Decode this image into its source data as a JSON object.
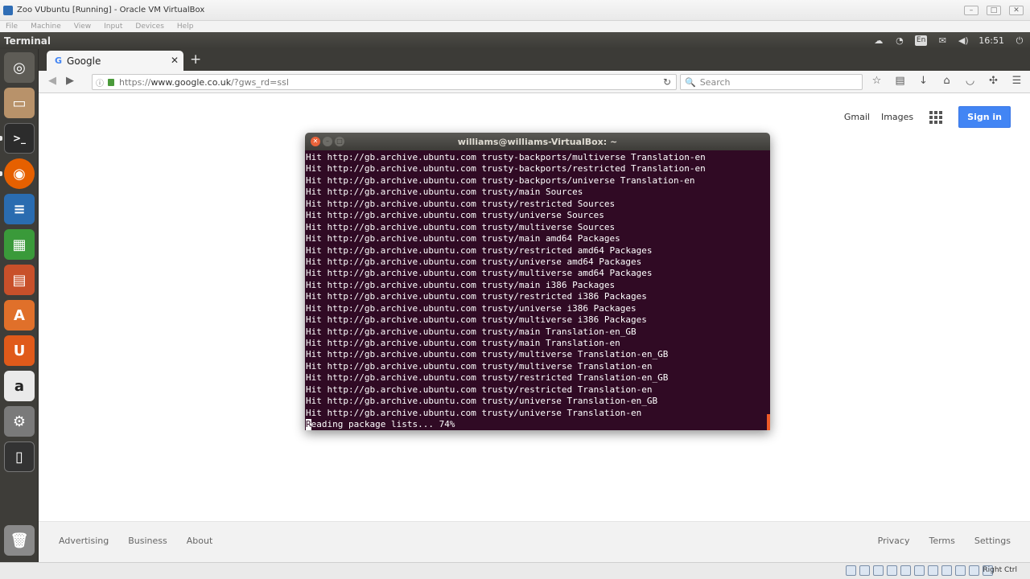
{
  "vbox": {
    "title": "Zoo VUbuntu [Running] - Oracle VM VirtualBox",
    "menu": [
      "File",
      "Machine",
      "View",
      "Input",
      "Devices",
      "Help"
    ],
    "host_key": "Right Ctrl"
  },
  "ubuntu_panel": {
    "app_title": "Terminal",
    "keyboard_layout": "En",
    "clock": "16:51"
  },
  "firefox": {
    "tab_title": "Google",
    "url_scheme": "https://",
    "url_host": "www.google.co.uk",
    "url_path": "/?gws_rd=ssl",
    "search_placeholder": "Search"
  },
  "google": {
    "header_links": {
      "gmail": "Gmail",
      "images": "Images",
      "sign_in": "Sign in"
    },
    "footer_left": [
      "Advertising",
      "Business",
      "About"
    ],
    "footer_right": [
      "Privacy",
      "Terms",
      "Settings"
    ],
    "accent_color": "#4285f4"
  },
  "terminal": {
    "title": "williams@williams-VirtualBox: ~",
    "lines": [
      "Hit http://gb.archive.ubuntu.com trusty-backports/multiverse Translation-en",
      "Hit http://gb.archive.ubuntu.com trusty-backports/restricted Translation-en",
      "Hit http://gb.archive.ubuntu.com trusty-backports/universe Translation-en",
      "Hit http://gb.archive.ubuntu.com trusty/main Sources",
      "Hit http://gb.archive.ubuntu.com trusty/restricted Sources",
      "Hit http://gb.archive.ubuntu.com trusty/universe Sources",
      "Hit http://gb.archive.ubuntu.com trusty/multiverse Sources",
      "Hit http://gb.archive.ubuntu.com trusty/main amd64 Packages",
      "Hit http://gb.archive.ubuntu.com trusty/restricted amd64 Packages",
      "Hit http://gb.archive.ubuntu.com trusty/universe amd64 Packages",
      "Hit http://gb.archive.ubuntu.com trusty/multiverse amd64 Packages",
      "Hit http://gb.archive.ubuntu.com trusty/main i386 Packages",
      "Hit http://gb.archive.ubuntu.com trusty/restricted i386 Packages",
      "Hit http://gb.archive.ubuntu.com trusty/universe i386 Packages",
      "Hit http://gb.archive.ubuntu.com trusty/multiverse i386 Packages",
      "Hit http://gb.archive.ubuntu.com trusty/main Translation-en_GB",
      "Hit http://gb.archive.ubuntu.com trusty/main Translation-en",
      "Hit http://gb.archive.ubuntu.com trusty/multiverse Translation-en_GB",
      "Hit http://gb.archive.ubuntu.com trusty/multiverse Translation-en",
      "Hit http://gb.archive.ubuntu.com trusty/restricted Translation-en_GB",
      "Hit http://gb.archive.ubuntu.com trusty/restricted Translation-en",
      "Hit http://gb.archive.ubuntu.com trusty/universe Translation-en_GB",
      "Hit http://gb.archive.ubuntu.com trusty/universe Translation-en"
    ],
    "last_line_cursor_char": "R",
    "last_line_rest": "eading package lists... 74%",
    "background_color": "#300a24"
  },
  "launcher": {
    "items": [
      {
        "icon": "dash-home-icon",
        "color": "#5e5c56"
      },
      {
        "icon": "files-icon",
        "color": "#b8926a"
      },
      {
        "icon": "terminal-icon",
        "color": "#2c2c2c"
      },
      {
        "icon": "firefox-icon",
        "color": "#e66000"
      },
      {
        "icon": "writer-icon",
        "color": "#2a6cb0"
      },
      {
        "icon": "calc-icon",
        "color": "#3a9a3a"
      },
      {
        "icon": "impress-icon",
        "color": "#c8502a"
      },
      {
        "icon": "software-center-icon",
        "color": "#e0702a"
      },
      {
        "icon": "ubuntu-one-icon",
        "color": "#e05a1a"
      },
      {
        "icon": "amazon-icon",
        "color": "#eaeaea"
      },
      {
        "icon": "system-settings-icon",
        "color": "#7a7a7a"
      },
      {
        "icon": "usb-drive-icon",
        "color": "#333333"
      },
      {
        "icon": "trash-icon",
        "color": "#8a8a8a"
      }
    ]
  }
}
